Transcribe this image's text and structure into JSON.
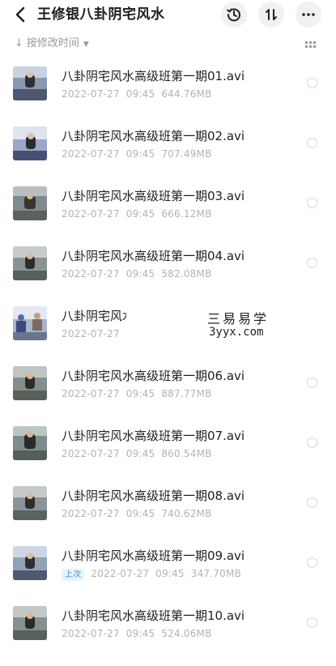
{
  "header": {
    "title": "王修银八卦阴宅风水",
    "back_icon": "back-arrow-icon",
    "history_icon": "history-icon",
    "sort_toggle_icon": "sort-toggle-icon",
    "more_icon": "more-icon"
  },
  "sortbar": {
    "label": "按修改时间",
    "sort_icon": "sort-arrow-icon",
    "chevron_icon": "chevron-down-icon",
    "view_icon": "grid-view-icon"
  },
  "files": [
    {
      "name": "八卦阴宅风水高级班第一期01.avi",
      "date": "2022-07-27",
      "time": "09:45",
      "size": "644.76MB"
    },
    {
      "name": "八卦阴宅风水高级班第一期02.avi",
      "date": "2022-07-27",
      "time": "09:45",
      "size": "707.49MB"
    },
    {
      "name": "八卦阴宅风水高级班第一期03.avi",
      "date": "2022-07-27",
      "time": "09:45",
      "size": "666.12MB"
    },
    {
      "name": "八卦阴宅风水高级班第一期04.avi",
      "date": "2022-07-27",
      "time": "09:45",
      "size": "582.08MB"
    },
    {
      "name": "八卦阴宅风水",
      "date": "2022-07-27",
      "time": "",
      "size": ""
    },
    {
      "name": "八卦阴宅风水高级班第一期06.avi",
      "date": "2022-07-27",
      "time": "09:45",
      "size": "887.77MB"
    },
    {
      "name": "八卦阴宅风水高级班第一期07.avi",
      "date": "2022-07-27",
      "time": "09:45",
      "size": "860.54MB"
    },
    {
      "name": "八卦阴宅风水高级班第一期08.avi",
      "date": "2022-07-27",
      "time": "09:45",
      "size": "740.62MB"
    },
    {
      "name": "八卦阴宅风水高级班第一期09.avi",
      "badge": "上次",
      "date": "2022-07-27",
      "time": "09:45",
      "size": "347.70MB"
    },
    {
      "name": "八卦阴宅风水高级班第一期10.avi",
      "date": "2022-07-27",
      "time": "09:45",
      "size": "524.06MB"
    }
  ],
  "watermark": {
    "line1": "三易易学",
    "line2": "3yyx.com"
  },
  "colors": {
    "accent": "#3a8ee6",
    "meta_text": "#b3b3b3",
    "title_text": "#1d1d1d"
  }
}
